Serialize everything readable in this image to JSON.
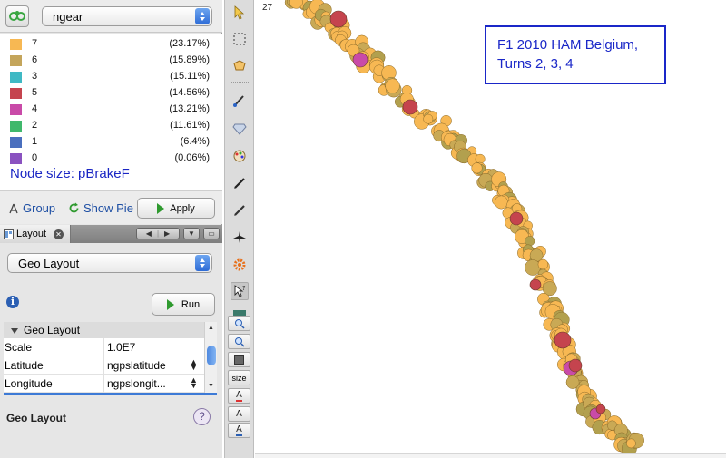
{
  "attribute_selector": {
    "value": "ngear"
  },
  "legend": {
    "items": [
      {
        "label": "7",
        "pct": "(23.17%)",
        "color": "#f7b853"
      },
      {
        "label": "6",
        "pct": "(15.89%)",
        "color": "#c4a55b"
      },
      {
        "label": "3",
        "pct": "(15.11%)",
        "color": "#3fb9c4"
      },
      {
        "label": "5",
        "pct": "(14.56%)",
        "color": "#c5444e"
      },
      {
        "label": "4",
        "pct": "(13.21%)",
        "color": "#c94aa8"
      },
      {
        "label": "2",
        "pct": "(11.61%)",
        "color": "#3fb86c"
      },
      {
        "label": "1",
        "pct": "(6.4%)",
        "color": "#4a6fbe"
      },
      {
        "label": "0",
        "pct": "(0.06%)",
        "color": "#8a52c0"
      }
    ],
    "node_size": "Node size: pBrakeF"
  },
  "actions": {
    "group": "Group",
    "show_pie": "Show Pie",
    "apply": "Apply"
  },
  "tab": {
    "label": "Layout"
  },
  "layout_panel": {
    "layout_select": "Geo Layout",
    "run": "Run",
    "section": "Geo Layout",
    "properties": [
      {
        "key": "Scale",
        "value": "1.0E7"
      },
      {
        "key": "Latitude",
        "value": "ngpslatitude"
      },
      {
        "key": "Longitude",
        "value": "ngpslongit..."
      }
    ],
    "footer": "Geo Layout"
  },
  "toolbar": {
    "size_label": "size",
    "text_label": "A"
  },
  "canvas": {
    "node_label": "27",
    "annotation_line1": "F1 2010 HAM Belgium,",
    "annotation_line2": "Turns 2, 3, 4"
  }
}
